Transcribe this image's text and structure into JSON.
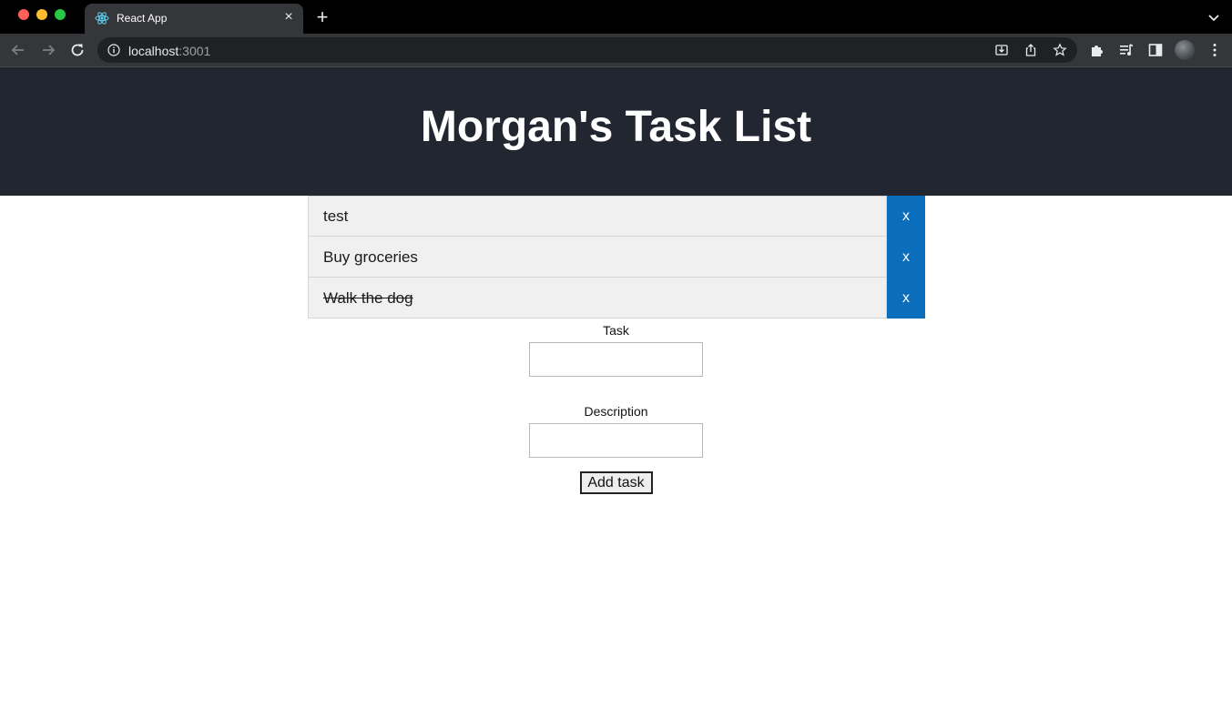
{
  "browser": {
    "tab_title": "React App",
    "tab_close_glyph": "×",
    "new_tab_glyph": "+",
    "url_host": "localhost",
    "url_port": ":3001",
    "icons": [
      "react-favicon-icon",
      "back-arrow-icon",
      "forward-arrow-icon",
      "reload-icon",
      "site-info-icon",
      "install-app-icon",
      "share-icon",
      "bookmark-star-icon",
      "extensions-puzzle-icon",
      "media-control-icon",
      "side-panel-icon",
      "profile-avatar",
      "kebab-menu-icon",
      "tab-search-chevron-icon"
    ]
  },
  "header": {
    "title": "Morgan's Task List"
  },
  "tasks": [
    {
      "title": "test",
      "completed": false,
      "delete_label": "x"
    },
    {
      "title": "Buy groceries",
      "completed": false,
      "delete_label": "x"
    },
    {
      "title": "Walk the dog",
      "completed": true,
      "delete_label": "x"
    }
  ],
  "form": {
    "task_label": "Task",
    "task_value": "",
    "description_label": "Description",
    "description_value": "",
    "submit_label": "Add task"
  },
  "colors": {
    "header_bg": "#222630",
    "delete_button_bg": "#0a6ebd",
    "task_row_bg": "#f0f0f0"
  }
}
